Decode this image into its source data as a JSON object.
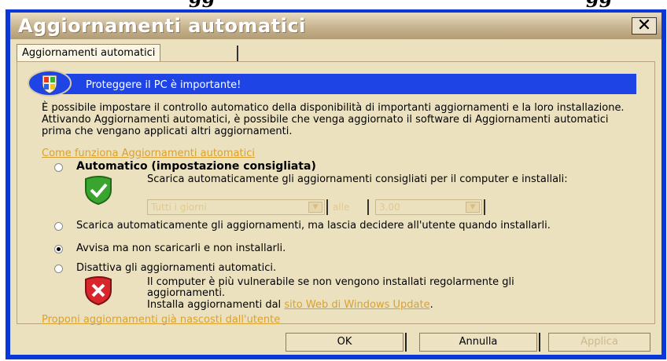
{
  "top_fragment": {
    "left": "gg",
    "right": "gg"
  },
  "window": {
    "title": "Aggiornamenti automatici",
    "close_glyph": "✕"
  },
  "tab": {
    "label": "Aggiornamenti automatici"
  },
  "banner": {
    "text": "Proteggere il PC è importante!",
    "icon": "windows-shield-icon"
  },
  "intro_text": "È possibile impostare il controllo automatico della disponibilità di importanti aggiornamenti e la loro installazione. Attivando Aggiornamenti automatici, è possibile che venga aggiornato il software di Aggiornamenti automatici prima che vengano applicati altri aggiornamenti.",
  "help_link": "Come funziona Aggiornamenti automatici",
  "options": {
    "automatic": {
      "label": "Automatico (impostazione consigliata)",
      "description": "Scarica automaticamente gli aggiornamenti consigliati per il computer e installali:",
      "day_value": "Tutti i giorni",
      "alle_label": "alle",
      "time_value": "3.00",
      "icon": "green-check-shield-icon",
      "selected": false
    },
    "download_only": {
      "label": "Scarica automaticamente gli aggiornamenti, ma lascia decidere all'utente quando installarli.",
      "selected": false
    },
    "notify": {
      "label": "Avvisa ma non scaricarli e non installarli.",
      "selected": true
    },
    "disable": {
      "label": "Disattiva gli aggiornamenti automatici.",
      "description": "Il computer è più vulnerabile se non vengono installati regolarmente gli aggiornamenti.",
      "install_prefix": "Installa aggiornamenti dal",
      "install_link": "sito Web di Windows Update",
      "install_suffix": ".",
      "icon": "red-x-shield-icon",
      "selected": false
    }
  },
  "hidden_updates_link": "Proponi aggiornamenti già nascosti dall'utente",
  "buttons": {
    "ok": "OK",
    "cancel": "Annulla",
    "apply": "Applica"
  },
  "colors": {
    "frame_blue": "#0a37d8",
    "banner_blue": "#1e44e6",
    "dialog_bg": "#ece1bf",
    "link": "#d9a12e"
  }
}
